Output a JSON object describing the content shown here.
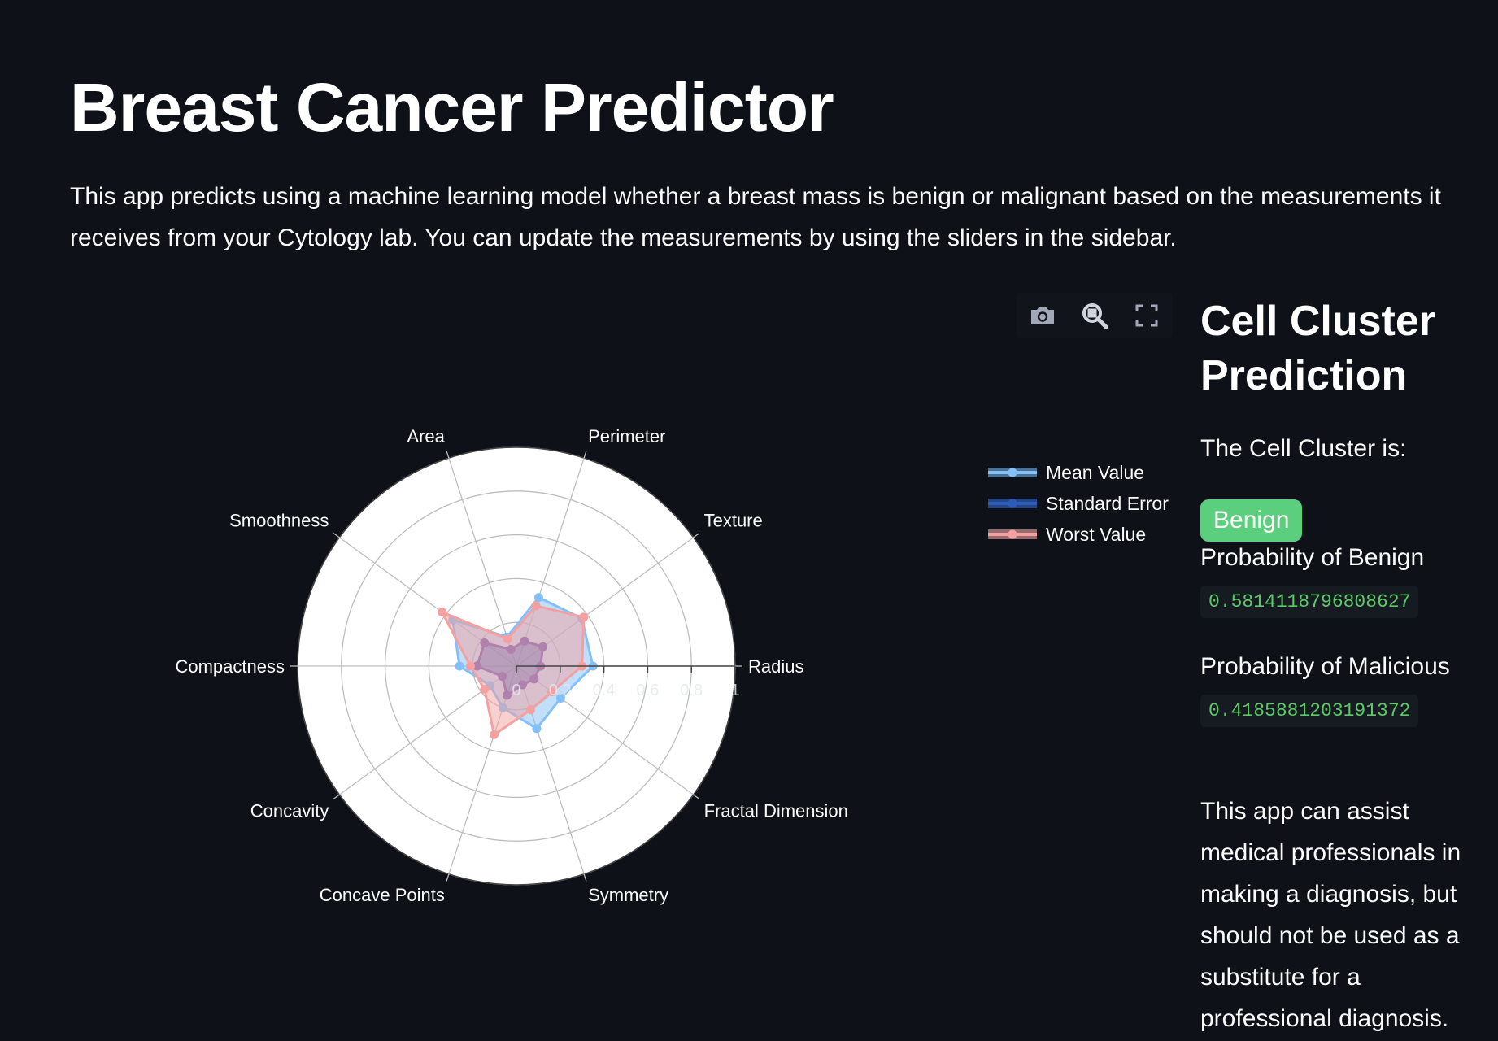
{
  "header": {
    "title": "Breast Cancer Predictor",
    "description": "This app predicts using a machine learning model whether a breast mass is benign or malignant based on the measurements it receives from your Cytology lab. You can update the measurements by using the sliders in the sidebar."
  },
  "toolbar": {
    "icons": [
      "camera-icon",
      "zoom-icon",
      "fullscreen-icon"
    ]
  },
  "chart_data": {
    "type": "radar",
    "categories": [
      "Radius",
      "Texture",
      "Perimeter",
      "Area",
      "Smoothness",
      "Compactness",
      "Concavity",
      "Concave Points",
      "Symmetry",
      "Fractal Dimension"
    ],
    "radial_ticks": [
      "0",
      "0.2",
      "0.4",
      "0.6",
      "0.8",
      "1"
    ],
    "radial_range": [
      0,
      1
    ],
    "series": [
      {
        "name": "Mean Value",
        "color": "#83c0f8",
        "values": [
          0.35,
          0.37,
          0.33,
          0.14,
          0.36,
          0.26,
          0.15,
          0.2,
          0.3,
          0.25
        ]
      },
      {
        "name": "Standard Error",
        "color": "#4a6fbe",
        "values": [
          0.11,
          0.15,
          0.12,
          0.08,
          0.18,
          0.18,
          0.08,
          0.14,
          0.09,
          0.1
        ]
      },
      {
        "name": "Worst Value",
        "color": "#f4a0a0",
        "values": [
          0.3,
          0.38,
          0.29,
          0.13,
          0.42,
          0.21,
          0.18,
          0.33,
          0.21,
          0.2
        ]
      }
    ],
    "grid": true,
    "legend_position": "right"
  },
  "prediction": {
    "title": "Cell Cluster Prediction",
    "label": "The Cell Cluster is:",
    "result": "Benign",
    "result_color": "#5ccf7e",
    "benign_label": "Probability of Benign",
    "benign_value": "0.5814118796808627",
    "malicious_label": "Probability of Malicious",
    "malicious_value": "0.4185881203191372",
    "note": "This app can assist medical professionals in making a diagnosis, but should not be used as a substitute for a professional diagnosis."
  }
}
